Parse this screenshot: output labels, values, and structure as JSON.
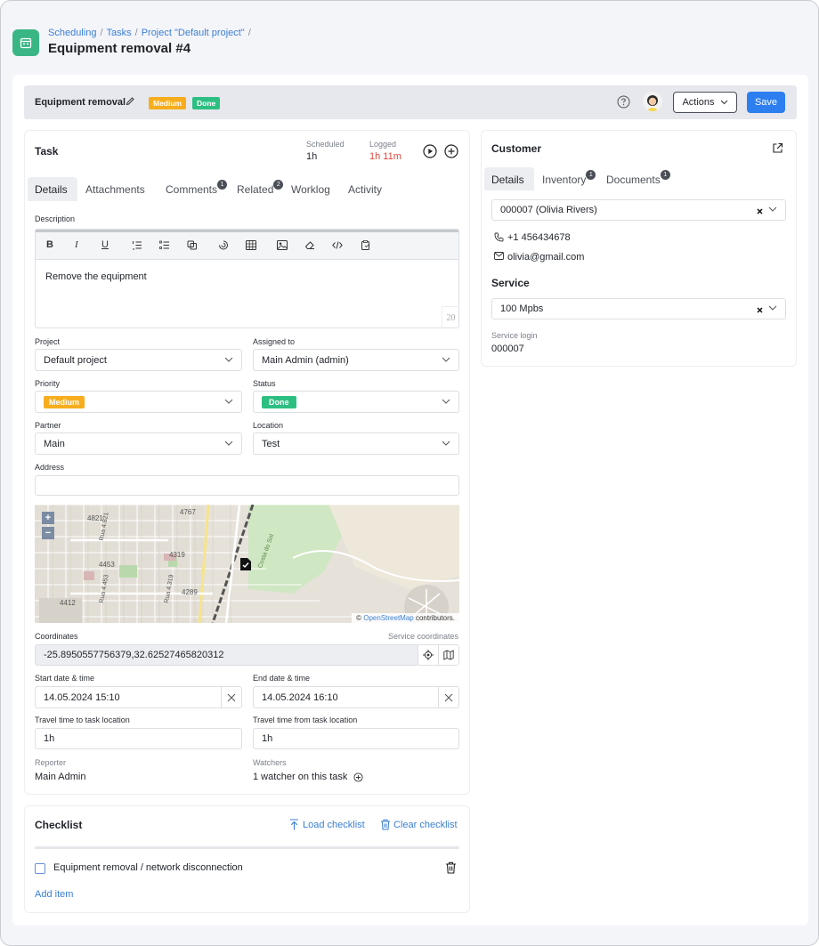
{
  "breadcrumb": [
    "Scheduling",
    "Tasks",
    "Project \"Default project\""
  ],
  "breadcrumb_sep": "/",
  "page_title": "Equipment removal #4",
  "topbar": {
    "title": "Equipment removal",
    "priority_badge": "Medium",
    "status_badge": "Done",
    "actions_label": "Actions",
    "save_label": "Save"
  },
  "task": {
    "heading": "Task",
    "scheduled_label": "Scheduled",
    "scheduled_value": "1h",
    "logged_label": "Logged",
    "logged_value": "1h 11m",
    "tabs": [
      {
        "label": "Details"
      },
      {
        "label": "Attachments"
      },
      {
        "label": "Comments",
        "count": "1"
      },
      {
        "label": "Related",
        "count": "2"
      },
      {
        "label": "Worklog"
      },
      {
        "label": "Activity"
      }
    ],
    "description_label": "Description",
    "description_text": "Remove the equipment",
    "char_count": "20",
    "project_label": "Project",
    "project_value": "Default project",
    "assigned_label": "Assigned to",
    "assigned_value": "Main Admin (admin)",
    "priority_label": "Priority",
    "priority_value": "Medium",
    "status_label": "Status",
    "status_value": "Done",
    "partner_label": "Partner",
    "partner_value": "Main",
    "location_label": "Location",
    "location_value": "Test",
    "address_label": "Address",
    "address_value": "",
    "coordinates_label": "Coordinates",
    "service_coords_label": "Service coordinates",
    "coordinates_value": "-25.8950557756379,32.62527465820312",
    "start_label": "Start date & time",
    "start_value": "14.05.2024 15:10",
    "end_label": "End date & time",
    "end_value": "14.05.2024 16:10",
    "travel_to_label": "Travel time to task location",
    "travel_to_value": "1h",
    "travel_from_label": "Travel time from task location",
    "travel_from_value": "1h",
    "reporter_label": "Reporter",
    "reporter_value": "Main Admin",
    "watchers_label": "Watchers",
    "watchers_value": "1 watcher on this task"
  },
  "map": {
    "zoom_in": "+",
    "zoom_out": "−",
    "labels": [
      "4767",
      "4821",
      "4319",
      "4453",
      "4289",
      "4412",
      "Rua 4.821",
      "Rua 4.453",
      "Rua 4.319",
      "Costa do Sol"
    ],
    "attribution_prefix": "©",
    "attribution_link": "OpenStreetMap",
    "attribution_suffix": "contributors."
  },
  "checklist": {
    "heading": "Checklist",
    "load_label": "Load checklist",
    "clear_label": "Clear checklist",
    "items": [
      {
        "label": "Equipment removal / network disconnection",
        "checked": false
      }
    ],
    "add_label": "Add item"
  },
  "customer": {
    "heading": "Customer",
    "tabs": [
      {
        "label": "Details"
      },
      {
        "label": "Inventory",
        "count": "1"
      },
      {
        "label": "Documents",
        "count": "1"
      }
    ],
    "account_value": "000007 (Olivia Rivers)",
    "phone": "+1 456434678",
    "email": "olivia@gmail.com",
    "service_heading": "Service",
    "service_value": "100 Mpbs",
    "service_login_label": "Service login",
    "service_login_value": "000007"
  },
  "colors": {
    "accent": "#2d7ff0",
    "medium": "#f7ad1e",
    "done": "#2dbf82",
    "logged": "#e0483c",
    "app_icon": "#3ab685"
  }
}
